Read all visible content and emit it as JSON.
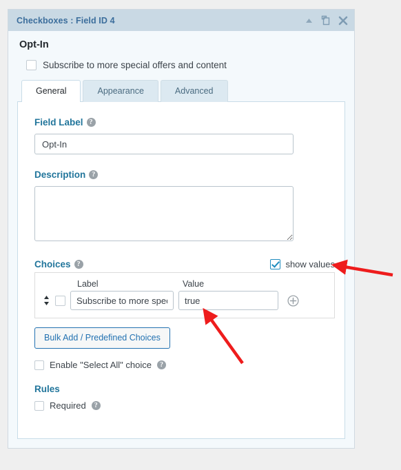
{
  "panel": {
    "title": "Checkboxes : Field ID 4",
    "icons": [
      {
        "name": "collapse-icon",
        "glyph": "triangle-up"
      },
      {
        "name": "duplicate-icon",
        "glyph": "copy"
      },
      {
        "name": "close-icon",
        "glyph": "x"
      }
    ],
    "titlebar_bg": "#c9d9e4",
    "title_color": "#3c6e9c"
  },
  "preview": {
    "field_label": "Opt-In",
    "choice_text": "Subscribe to more special offers and content",
    "choice_checked": false
  },
  "tabs": [
    {
      "label": "General",
      "active": true
    },
    {
      "label": "Appearance",
      "active": false
    },
    {
      "label": "Advanced",
      "active": false
    }
  ],
  "general": {
    "field_label_heading": "Field Label",
    "field_label_help": "?",
    "field_label_value": "Opt-In",
    "description_heading": "Description",
    "description_help": "?",
    "description_value": "",
    "choices_heading": "Choices",
    "choices_help": "?",
    "show_values_label": "show values",
    "show_values_checked": true,
    "columns": {
      "label": "Label",
      "value": "Value"
    },
    "choices": [
      {
        "checked": false,
        "label": "Subscribe to more speci",
        "value": "true"
      }
    ],
    "add_choice_icon": "plus-circle-icon",
    "bulk_button": "Bulk Add / Predefined Choices",
    "select_all": {
      "label": "Enable \"Select All\" choice",
      "help": "?",
      "checked": false
    },
    "rules_heading": "Rules",
    "required": {
      "label": "Required",
      "help": "?",
      "checked": false
    }
  },
  "annotations": {
    "accent_color": "#ee1c1c",
    "arrow_show_values": "arrow pointing left at show values checkbox",
    "arrow_value_field": "arrow pointing up-left at value input"
  }
}
